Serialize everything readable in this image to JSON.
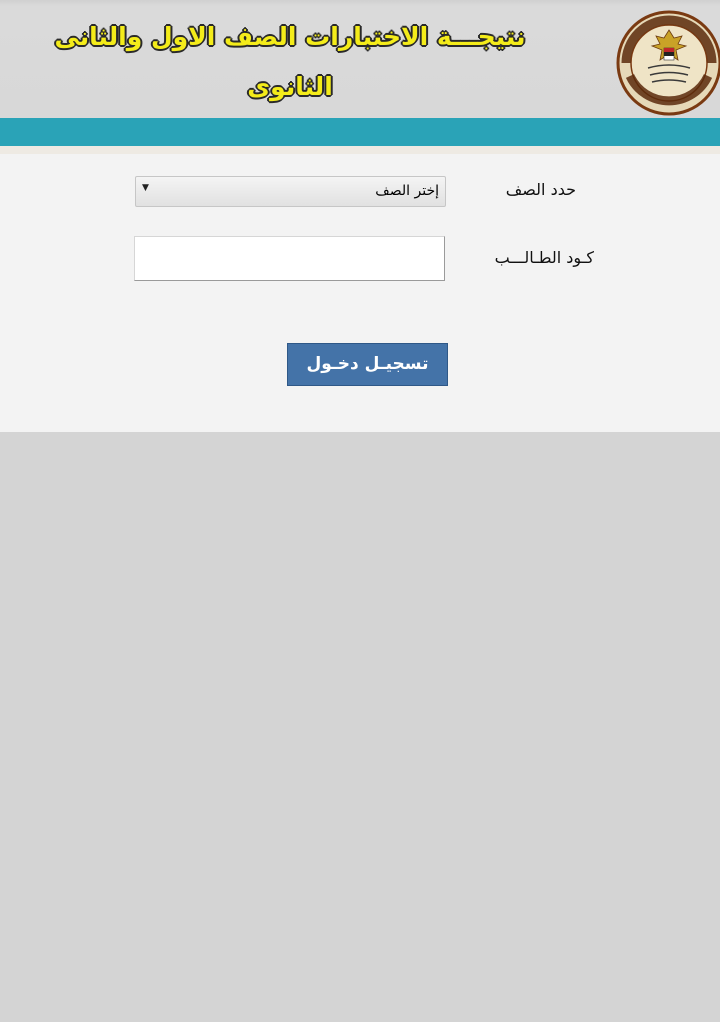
{
  "header": {
    "title": "نتيجـــة  الاختبارات الصف الاول والثانى الثانوى",
    "logo": {
      "icon": "ministry-of-education-seal-icon",
      "arabic_text": "وزارة التربية والتعليم والتعليم الفنى",
      "english_text": "MINISTRY OF EDUCATION AND TECHNICAL EDUCATION"
    }
  },
  "colors": {
    "header_bg": "#d8d8d8",
    "title_yellow": "#f4ec1a",
    "teal_bar": "#2aa3b7",
    "form_bg": "#f3f3f3",
    "button_blue": "#4473a8",
    "page_bg": "#d4d4d4"
  },
  "form": {
    "grade_label": "حدد الصف",
    "grade_select": {
      "selected": "إختر الصف",
      "arrow_icon": "dropdown-triangle-icon"
    },
    "code_label": "كـود الطـالـــب",
    "code_input": {
      "value": "",
      "placeholder": ""
    },
    "login_button": "تسجيـل دخـول"
  }
}
